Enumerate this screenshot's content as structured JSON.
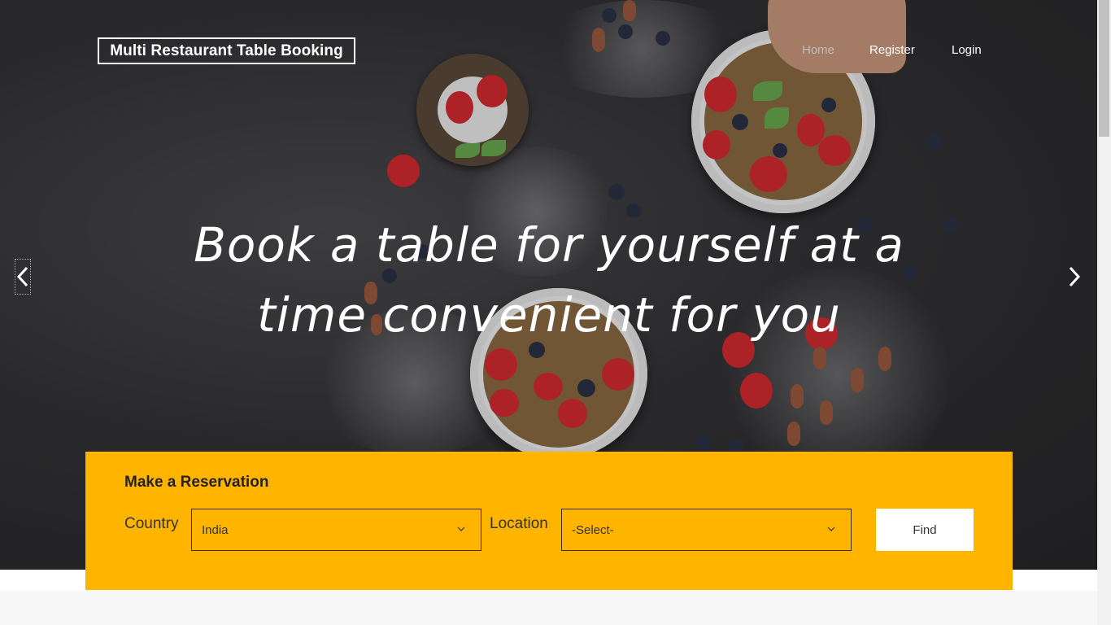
{
  "brand": {
    "title": "Multi Restaurant Table Booking"
  },
  "nav": {
    "home": "Home",
    "register": "Register",
    "login": "Login"
  },
  "hero": {
    "headline_line1": "Book a table for yourself at a",
    "headline_line2": "time convenient for you"
  },
  "carousel": {
    "prev_icon": "chevron-left-icon",
    "next_icon": "chevron-right-icon"
  },
  "reservation": {
    "title": "Make a Reservation",
    "country_label": "Country",
    "country_value": "India",
    "location_label": "Location",
    "location_value": "-Select-",
    "find_label": "Find"
  },
  "colors": {
    "accent": "#ffb400",
    "text_dark": "#222222",
    "white": "#ffffff"
  }
}
